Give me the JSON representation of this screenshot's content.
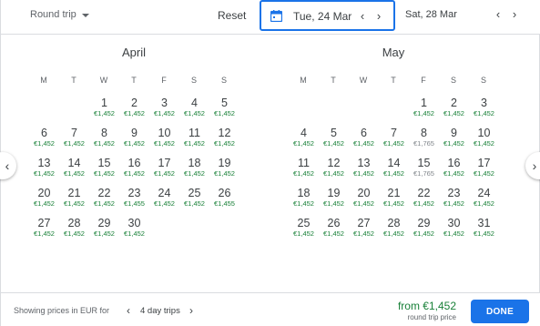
{
  "header": {
    "trip_type": "Round trip",
    "reset_label": "Reset",
    "departure_date": "Tue, 24 Mar",
    "return_date": "Sat, 28 Mar"
  },
  "weekdays": [
    "M",
    "T",
    "W",
    "T",
    "F",
    "S",
    "S"
  ],
  "months": [
    {
      "title": "April",
      "first_weekday": 2,
      "days": [
        {
          "d": "1",
          "p": "€1,452"
        },
        {
          "d": "2",
          "p": "€1,452"
        },
        {
          "d": "3",
          "p": "€1,452"
        },
        {
          "d": "4",
          "p": "€1,452"
        },
        {
          "d": "5",
          "p": "€1,452"
        },
        {
          "d": "6",
          "p": "€1,452"
        },
        {
          "d": "7",
          "p": "€1,452"
        },
        {
          "d": "8",
          "p": "€1,452"
        },
        {
          "d": "9",
          "p": "€1,452"
        },
        {
          "d": "10",
          "p": "€1,452"
        },
        {
          "d": "11",
          "p": "€1,452"
        },
        {
          "d": "12",
          "p": "€1,452"
        },
        {
          "d": "13",
          "p": "€1,452"
        },
        {
          "d": "14",
          "p": "€1,452"
        },
        {
          "d": "15",
          "p": "€1,452"
        },
        {
          "d": "16",
          "p": "€1,452"
        },
        {
          "d": "17",
          "p": "€1,452"
        },
        {
          "d": "18",
          "p": "€1,452"
        },
        {
          "d": "19",
          "p": "€1,452"
        },
        {
          "d": "20",
          "p": "€1,452"
        },
        {
          "d": "21",
          "p": "€1,452"
        },
        {
          "d": "22",
          "p": "€1,452"
        },
        {
          "d": "23",
          "p": "€1,455"
        },
        {
          "d": "24",
          "p": "€1,452"
        },
        {
          "d": "25",
          "p": "€1,452"
        },
        {
          "d": "26",
          "p": "€1,455"
        },
        {
          "d": "27",
          "p": "€1,452"
        },
        {
          "d": "28",
          "p": "€1,452"
        },
        {
          "d": "29",
          "p": "€1,452"
        },
        {
          "d": "30",
          "p": "€1,452"
        }
      ]
    },
    {
      "title": "May",
      "first_weekday": 4,
      "days": [
        {
          "d": "1",
          "p": "€1,452"
        },
        {
          "d": "2",
          "p": "€1,452"
        },
        {
          "d": "3",
          "p": "€1,452"
        },
        {
          "d": "4",
          "p": "€1,452"
        },
        {
          "d": "5",
          "p": "€1,452"
        },
        {
          "d": "6",
          "p": "€1,452"
        },
        {
          "d": "7",
          "p": "€1,452"
        },
        {
          "d": "8",
          "p": "€1,765",
          "grey": true
        },
        {
          "d": "9",
          "p": "€1,452"
        },
        {
          "d": "10",
          "p": "€1,452"
        },
        {
          "d": "11",
          "p": "€1,452"
        },
        {
          "d": "12",
          "p": "€1,452"
        },
        {
          "d": "13",
          "p": "€1,452"
        },
        {
          "d": "14",
          "p": "€1,452"
        },
        {
          "d": "15",
          "p": "€1,765",
          "grey": true
        },
        {
          "d": "16",
          "p": "€1,452"
        },
        {
          "d": "17",
          "p": "€1,452"
        },
        {
          "d": "18",
          "p": "€1,452"
        },
        {
          "d": "19",
          "p": "€1,452"
        },
        {
          "d": "20",
          "p": "€1,452"
        },
        {
          "d": "21",
          "p": "€1,452"
        },
        {
          "d": "22",
          "p": "€1,452"
        },
        {
          "d": "23",
          "p": "€1,452"
        },
        {
          "d": "24",
          "p": "€1,452"
        },
        {
          "d": "25",
          "p": "€1,452"
        },
        {
          "d": "26",
          "p": "€1,452"
        },
        {
          "d": "27",
          "p": "€1,452"
        },
        {
          "d": "28",
          "p": "€1,452"
        },
        {
          "d": "29",
          "p": "€1,452"
        },
        {
          "d": "30",
          "p": "€1,452"
        },
        {
          "d": "31",
          "p": "€1,452"
        }
      ]
    }
  ],
  "footer": {
    "showing_label": "Showing prices in EUR for",
    "trip_length": "4 day trips",
    "from_price": "from €1,452",
    "price_sub": "round trip price",
    "done_label": "DONE"
  },
  "colors": {
    "accent": "#1a73e8",
    "price_green": "#188038",
    "price_grey": "#80868b"
  },
  "icons": {
    "dropdown": "chevron-down-icon",
    "calendar": "calendar-icon",
    "prev": "chevron-left-icon",
    "next": "chevron-right-icon"
  }
}
